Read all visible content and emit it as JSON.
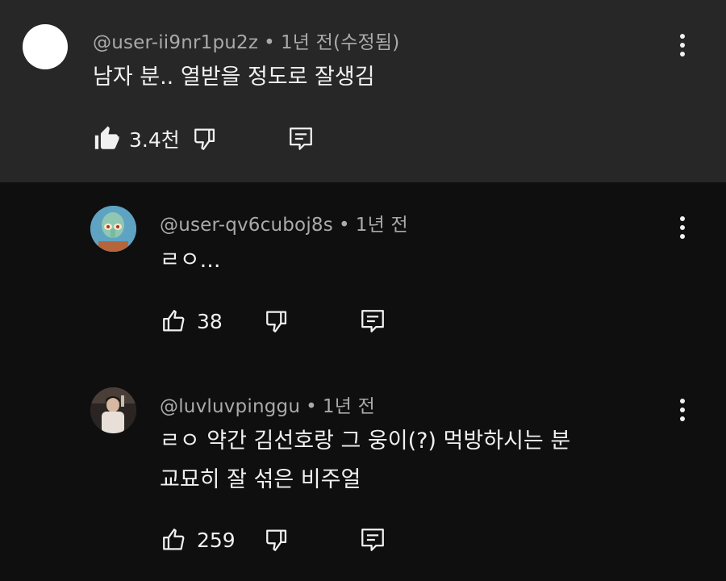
{
  "comments": [
    {
      "handle": "@user-ii9nr1pu2z",
      "time": "1년 전(수정됨)",
      "lines": [
        "남자 분.. 열받을 정도로 잘생김"
      ],
      "likes": "3.4천",
      "like_icon": "thumb-up-filled-icon"
    },
    {
      "handle": "@user-qv6cuboj8s",
      "time": "1년 전",
      "lines": [
        "ㄹㅇ..."
      ],
      "likes": "38",
      "like_icon": "thumb-up-outline-icon"
    },
    {
      "handle": "@luvluvpinggu",
      "time": "1년 전",
      "lines": [
        "ㄹㅇ 약간 김선호랑 그 웅이(?) 먹방하시는 분",
        "교묘히 잘 섞은 비주얼"
      ],
      "likes": "259",
      "like_icon": "thumb-up-outline-icon"
    }
  ],
  "separator": "•",
  "colors": {
    "background": "#0f0f0f",
    "highlight_background": "#272727",
    "text_primary": "#f1f1f1",
    "text_secondary": "#aaaaaa"
  }
}
